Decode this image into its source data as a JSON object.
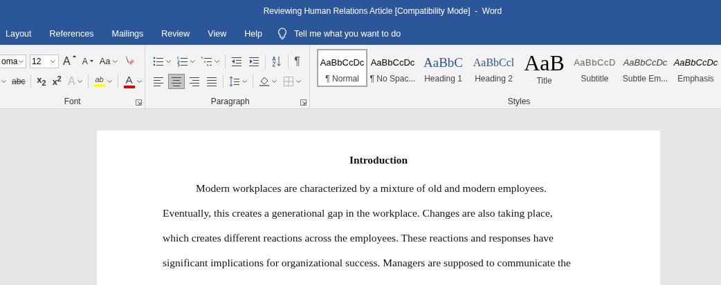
{
  "window": {
    "title": "Reviewing Human Relations Article [Compatibility Mode]  -  Word"
  },
  "tabs": [
    {
      "label": "Layout"
    },
    {
      "label": "References"
    },
    {
      "label": "Mailings"
    },
    {
      "label": "Review"
    },
    {
      "label": "View"
    },
    {
      "label": "Help"
    }
  ],
  "tell_me": {
    "placeholder": "Tell me what you want to do"
  },
  "font_group": {
    "label": "Font",
    "font_name": "oma",
    "font_size": "12",
    "row1": [
      {
        "kind": "grow",
        "label": "A"
      },
      {
        "kind": "shrink",
        "label": "A"
      },
      {
        "kind": "case",
        "label": "Aa"
      },
      {
        "kind": "clear"
      }
    ],
    "row2": [
      {
        "kind": "caret"
      },
      {
        "kind": "strike",
        "label": "abc"
      },
      {
        "kind": "sub",
        "label": "x$_{2}$"
      },
      {
        "kind": "sup",
        "label": "x$^{2}$"
      },
      {
        "kind": "effects",
        "label": "A",
        "disabled": true
      },
      {
        "kind": "highlight",
        "label": "ab",
        "color": "#ffff00"
      },
      {
        "kind": "fontcolor",
        "label": "A",
        "color": "#e00000"
      }
    ]
  },
  "paragraph_group": {
    "label": "Paragraph",
    "row1": [
      {
        "kind": "bullets"
      },
      {
        "kind": "numbering"
      },
      {
        "kind": "multilevel"
      },
      {
        "kind": "sep"
      },
      {
        "kind": "outdent"
      },
      {
        "kind": "indent"
      },
      {
        "kind": "sep"
      },
      {
        "kind": "sort"
      },
      {
        "kind": "sep"
      },
      {
        "kind": "pilcrow",
        "label": "¶"
      }
    ],
    "row2": [
      {
        "kind": "align-left",
        "selected": false
      },
      {
        "kind": "align-center",
        "selected": true
      },
      {
        "kind": "align-right",
        "selected": false
      },
      {
        "kind": "justify",
        "selected": false
      },
      {
        "kind": "sep"
      },
      {
        "kind": "spacing"
      },
      {
        "kind": "sep"
      },
      {
        "kind": "shading"
      },
      {
        "kind": "borders"
      }
    ]
  },
  "styles_group": {
    "label": "Styles",
    "items": [
      {
        "kind": "normal",
        "preview": "AaBbCcDc",
        "name": "¶ Normal",
        "selected": true
      },
      {
        "kind": "normal",
        "preview": "AaBbCcDc",
        "name": "¶ No Spac...",
        "selected": false
      },
      {
        "kind": "heading1",
        "preview": "AaBbC",
        "name": "Heading 1",
        "selected": false
      },
      {
        "kind": "heading2",
        "preview": "AaBbCcl",
        "name": "Heading 2",
        "selected": false
      },
      {
        "kind": "title",
        "preview": "AaB",
        "name": "Title",
        "selected": false
      },
      {
        "kind": "subtitle",
        "preview": "AaBbCcD",
        "name": "Subtitle",
        "selected": false
      },
      {
        "kind": "subtle-emphasis",
        "preview": "AaBbCcDc",
        "name": "Subtle Em...",
        "selected": false
      },
      {
        "kind": "emphasis",
        "preview": "AaBbCcDc",
        "name": "Emphasis",
        "selected": false
      }
    ]
  },
  "document": {
    "heading": "Introduction",
    "paragraph_lines": [
      "Modern workplaces are characterized by a mixture of old and modern employees.",
      "Eventually, this creates a generational gap in the workplace. Changes are also taking place,",
      "which creates different reactions across the employees. These reactions and responses have",
      "significant implications for organizational success. Managers are supposed to communicate the"
    ]
  }
}
